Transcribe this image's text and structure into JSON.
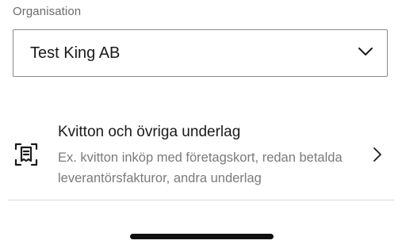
{
  "organisation": {
    "label": "Organisation",
    "selected_value": "Test King AB",
    "dropdown_icon": "chevron-down-icon"
  },
  "menu_item": {
    "icon": "receipt-scan-icon",
    "title": "Kvitton och övriga underlag",
    "description": "Ex. kvitton inköp med företagskort, redan betalda leverantörsfakturor, andra underlag",
    "trailing_icon": "chevron-right-icon"
  },
  "colors": {
    "text_primary": "#1a1a1a",
    "text_secondary": "#7a7a7a",
    "border": "#8a8a8a",
    "divider": "#d9d9d9",
    "home_indicator": "#111111"
  }
}
